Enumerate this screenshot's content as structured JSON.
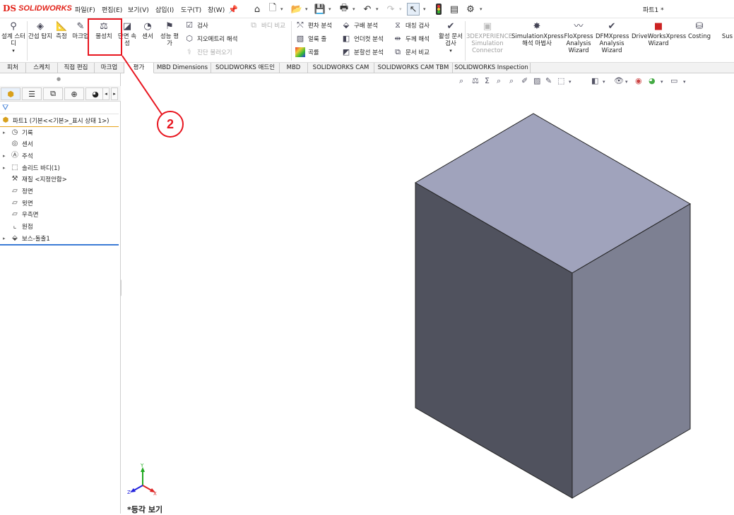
{
  "app": {
    "brand_prefix": "DS",
    "brand": "SOLIDWORKS",
    "document_title": "파트1 *"
  },
  "menu": [
    {
      "label": "파일(F)"
    },
    {
      "label": "편집(E)"
    },
    {
      "label": "보기(V)"
    },
    {
      "label": "삽입(I)"
    },
    {
      "label": "도구(T)"
    },
    {
      "label": "창(W)"
    }
  ],
  "ribbon": {
    "design_study": "설계 스터디",
    "interference": "간섭 탐지",
    "measure": "측정",
    "markup": "마크업",
    "mass_properties": "물성치",
    "section_properties": "단면 속성",
    "sensor": "센서",
    "performance_eval": "성능 평가",
    "check": "검사",
    "geometry_analysis": "지오메트리 해석",
    "import_diagnostics": "진단 불러오기",
    "body_compare": "바디 비교",
    "deviation_analysis": "편차 분석",
    "zebra_stripes": "얼룩 줄",
    "curvature": "곡률",
    "draft_analysis": "구배 분석",
    "undercut_analysis": "언더컷 분석",
    "parting_line_analysis": "분할선 분석",
    "symmetry_check": "대칭 검사",
    "thickness_analysis": "두께 해석",
    "compare_documents": "문서 비교",
    "active_doc_check": "활성 문서 검사",
    "experience_connector": "3DEXPERIENCE Simulation Connector",
    "simulation_xpress": "SimulationXpress 해석 마법사",
    "floxpress": "FloXpress Analysis Wizard",
    "dfmxpress": "DFMXpress Analysis Wizard",
    "driveworks": "DriveWorksXpress Wizard",
    "costing": "Costing",
    "sus": "Sus"
  },
  "tabs": [
    {
      "label": "피처"
    },
    {
      "label": "스케치"
    },
    {
      "label": "직접 편집"
    },
    {
      "label": "마크업"
    },
    {
      "label": "평가"
    },
    {
      "label": "MBD Dimensions"
    },
    {
      "label": "SOLIDWORKS 애드인"
    },
    {
      "label": "MBD"
    },
    {
      "label": "SOLIDWORKS CAM"
    },
    {
      "label": "SOLIDWORKS CAM TBM"
    },
    {
      "label": "SOLIDWORKS Inspection"
    }
  ],
  "active_tab": "평가",
  "tree": {
    "root": "파트1  (기본<<기본>_표시 상태 1>)",
    "items": [
      {
        "label": "기록"
      },
      {
        "label": "센서"
      },
      {
        "label": "주석"
      },
      {
        "label": "솔리드 바디(1)"
      },
      {
        "label": "재질 <지정안함>"
      },
      {
        "label": "정면"
      },
      {
        "label": "윗면"
      },
      {
        "label": "우측면"
      },
      {
        "label": "원점"
      },
      {
        "label": "보스-돌출1"
      }
    ]
  },
  "callout": {
    "number": "2"
  },
  "viewport": {
    "view_label": "*등각 보기"
  },
  "colors": {
    "highlight": "#e8151f",
    "accent_blue": "#3b7bd6",
    "box_top": "#a0a3bc",
    "box_left": "#50525e",
    "box_right": "#7d8092"
  }
}
